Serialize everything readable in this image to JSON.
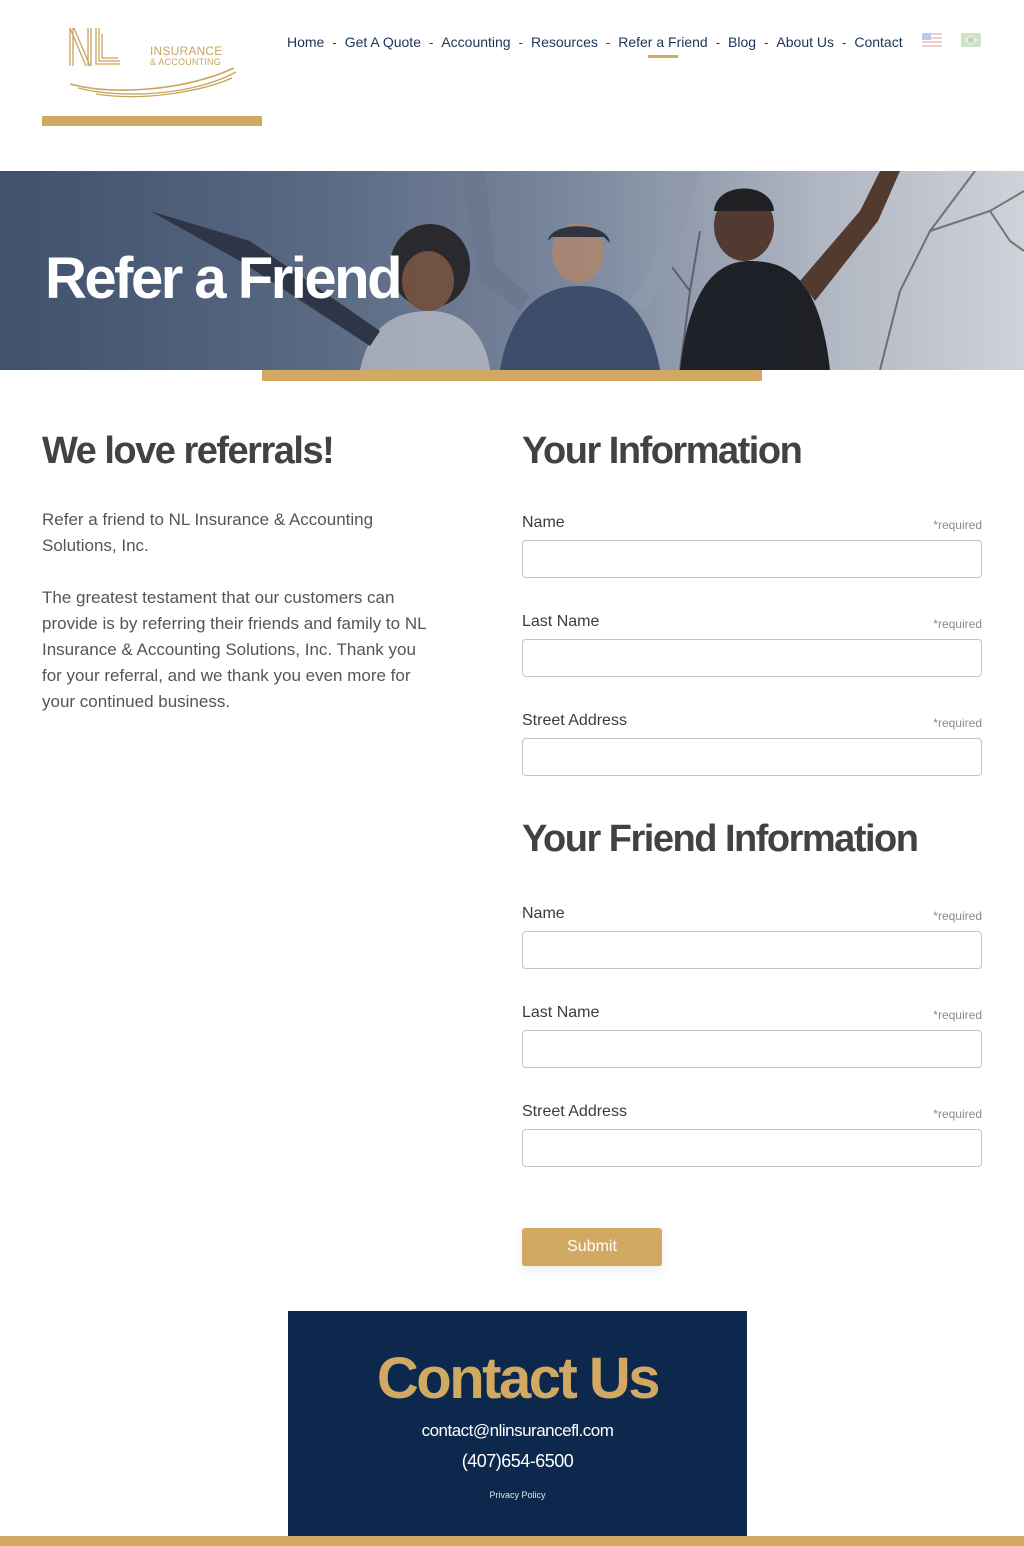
{
  "brand": {
    "logo_mark": "NL",
    "logo_line1": "INSURANCE",
    "logo_line2": "& ACCOUNTING",
    "accent_color": "#d1a963",
    "navy_color": "#0c284c"
  },
  "nav": {
    "items": [
      {
        "label": "Home"
      },
      {
        "label": "Get A Quote"
      },
      {
        "label": "Accounting"
      },
      {
        "label": "Resources"
      },
      {
        "label": "Refer a Friend",
        "active": true
      },
      {
        "label": "Blog"
      },
      {
        "label": "About Us"
      },
      {
        "label": "Contact"
      }
    ],
    "separator": "-",
    "flags": [
      "us-flag-icon",
      "brazil-flag-icon"
    ]
  },
  "hero": {
    "title": "Refer a Friend"
  },
  "intro": {
    "heading": "We love referrals!",
    "paragraph1": "Refer a friend to NL Insurance & Accounting Solutions, Inc.",
    "paragraph2": "The greatest testament that our customers can provide is by referring their friends and family to NL Insurance & Accounting Solutions, Inc. Thank you for your referral, and we thank you even more for your continued business."
  },
  "form": {
    "your_info": {
      "heading": "Your Information",
      "fields": [
        {
          "label": "Name",
          "required": "*required",
          "value": ""
        },
        {
          "label": "Last Name",
          "required": "*required",
          "value": ""
        },
        {
          "label": "Street Address",
          "required": "*required",
          "value": ""
        }
      ]
    },
    "friend_info": {
      "heading": "Your Friend Information",
      "fields": [
        {
          "label": "Name",
          "required": "*required",
          "value": ""
        },
        {
          "label": "Last Name",
          "required": "*required",
          "value": ""
        },
        {
          "label": "Street Address",
          "required": "*required",
          "value": ""
        }
      ]
    },
    "submit_label": "Submit"
  },
  "contact": {
    "title": "Contact Us",
    "email": "contact@nlinsurancefl.com",
    "phone": "(407)654-6500",
    "privacy": "Privacy Policy"
  }
}
